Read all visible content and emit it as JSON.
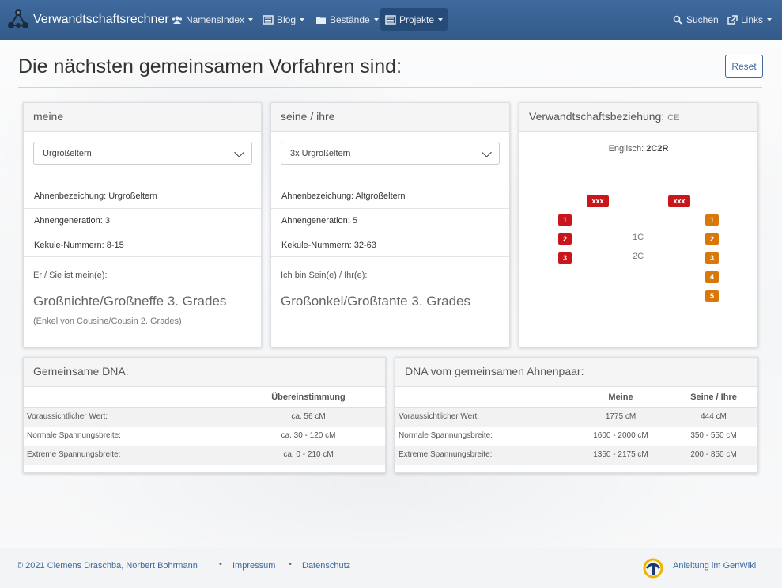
{
  "navbar": {
    "brand": "Verwandtschaftsrechner",
    "items": [
      {
        "label": "NamensIndex"
      },
      {
        "label": "Blog"
      },
      {
        "label": "Bestände"
      },
      {
        "label": "Projekte"
      }
    ],
    "search": "Suchen",
    "links": "Links"
  },
  "header": {
    "title": "Die nächsten gemeinsamen Vorfahren sind:",
    "reset": "Reset"
  },
  "meine": {
    "head": "meine",
    "selected": "Urgroßeltern",
    "rows": [
      "Ahnenbezeichung: Urgroßeltern",
      "Ahnengeneration: 3",
      "Kekule-Nummern: 8-15"
    ],
    "label": "Er / Sie ist mein(e):",
    "relation": "Großnichte/Großneffe 3. Grades",
    "sub": "(Enkel von Cousine/Cousin 2. Grades)"
  },
  "seine": {
    "head": "seine / ihre",
    "selected": "3x Urgroßeltern",
    "rows": [
      "Ahnenbezeichung: Altgroßeltern",
      "Ahnengeneration: 5",
      "Kekule-Nummern: 32-63"
    ],
    "label": "Ich bin Sein(e) / Ihr(e):",
    "relation": "Großonkel/Großtante 3. Grades"
  },
  "beziehung": {
    "head": "Verwandtschaftsbeziehung:",
    "code": "CE",
    "english_label": "Englisch:",
    "english_value": "2C2R",
    "top_left": "xxx",
    "top_right": "xxx",
    "left": [
      "1",
      "2",
      "3"
    ],
    "right": [
      "1",
      "2",
      "3",
      "4",
      "5"
    ],
    "degrees": [
      "1C",
      "2C"
    ]
  },
  "dna": {
    "head": "Gemeinsame DNA:",
    "col": "Übereinstimmung",
    "rows": [
      {
        "label": "Voraussichtlicher Wert:",
        "value": "ca. 56 cM"
      },
      {
        "label": "Normale Spannungsbreite:",
        "value": "ca. 30 - 120 cM"
      },
      {
        "label": "Extreme Spannungsbreite:",
        "value": "ca. 0 - 210 cM"
      }
    ]
  },
  "dna_pair": {
    "head": "DNA vom gemeinsamen Ahnenpaar:",
    "col1": "Meine",
    "col2": "Seine / Ihre",
    "rows": [
      {
        "label": "Voraussichtlicher Wert:",
        "v1": "1775 cM",
        "v2": "444 cM"
      },
      {
        "label": "Normale Spannungsbreite:",
        "v1": "1600 - 2000 cM",
        "v2": "350 - 550 cM"
      },
      {
        "label": "Extreme Spannungsbreite:",
        "v1": "1350 - 2175 cM",
        "v2": "200 - 850 cM"
      }
    ]
  },
  "footer": {
    "copyright": "© 2021 Clemens Draschba, Norbert Bohrmann",
    "impressum": "Impressum",
    "datenschutz": "Datenschutz",
    "genwiki": "Anleitung im GenWiki",
    "sep": "•"
  },
  "colors": {
    "navbar": "#3a6393",
    "badge_red": "#c9161a",
    "badge_orange": "#d9780a",
    "link": "#3f6a9e"
  }
}
